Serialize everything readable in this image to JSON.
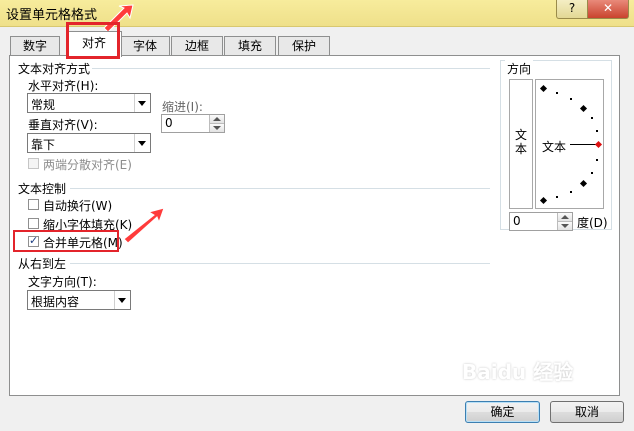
{
  "window": {
    "title": "设置单元格格式",
    "help_label": "?",
    "close_label": "✕"
  },
  "tabs": [
    {
      "label": "数字"
    },
    {
      "label": "对齐"
    },
    {
      "label": "字体"
    },
    {
      "label": "边框"
    },
    {
      "label": "填充"
    },
    {
      "label": "保护"
    }
  ],
  "active_tab": "对齐",
  "text_alignment": {
    "section_title": "文本对齐方式",
    "horizontal_label": "水平对齐(H):",
    "horizontal_value": "常规",
    "indent_label": "缩进(I):",
    "indent_value": "0",
    "vertical_label": "垂直对齐(V):",
    "vertical_value": "靠下",
    "justify_distributed_label": "两端分散对齐(E)"
  },
  "text_control": {
    "section_title": "文本控制",
    "wrap_text": {
      "label": "自动换行(W)",
      "checked": false
    },
    "shrink_to_fit": {
      "label": "缩小字体填充(K)",
      "checked": false
    },
    "merge_cells": {
      "label": "合并单元格(M)",
      "checked": true
    }
  },
  "rtl": {
    "section_title": "从右到左",
    "direction_label": "文字方向(T):",
    "direction_value": "根据内容"
  },
  "orientation": {
    "section_title": "方向",
    "vertical_text": "文本",
    "dial_text": "文本",
    "degree_value": "0",
    "degree_label": "度(D)"
  },
  "buttons": {
    "ok": "确定",
    "cancel": "取消"
  },
  "watermark": "Baidu 经验",
  "colors": {
    "highlight": "#e3242b",
    "titlebar": "#f7ec9c"
  }
}
